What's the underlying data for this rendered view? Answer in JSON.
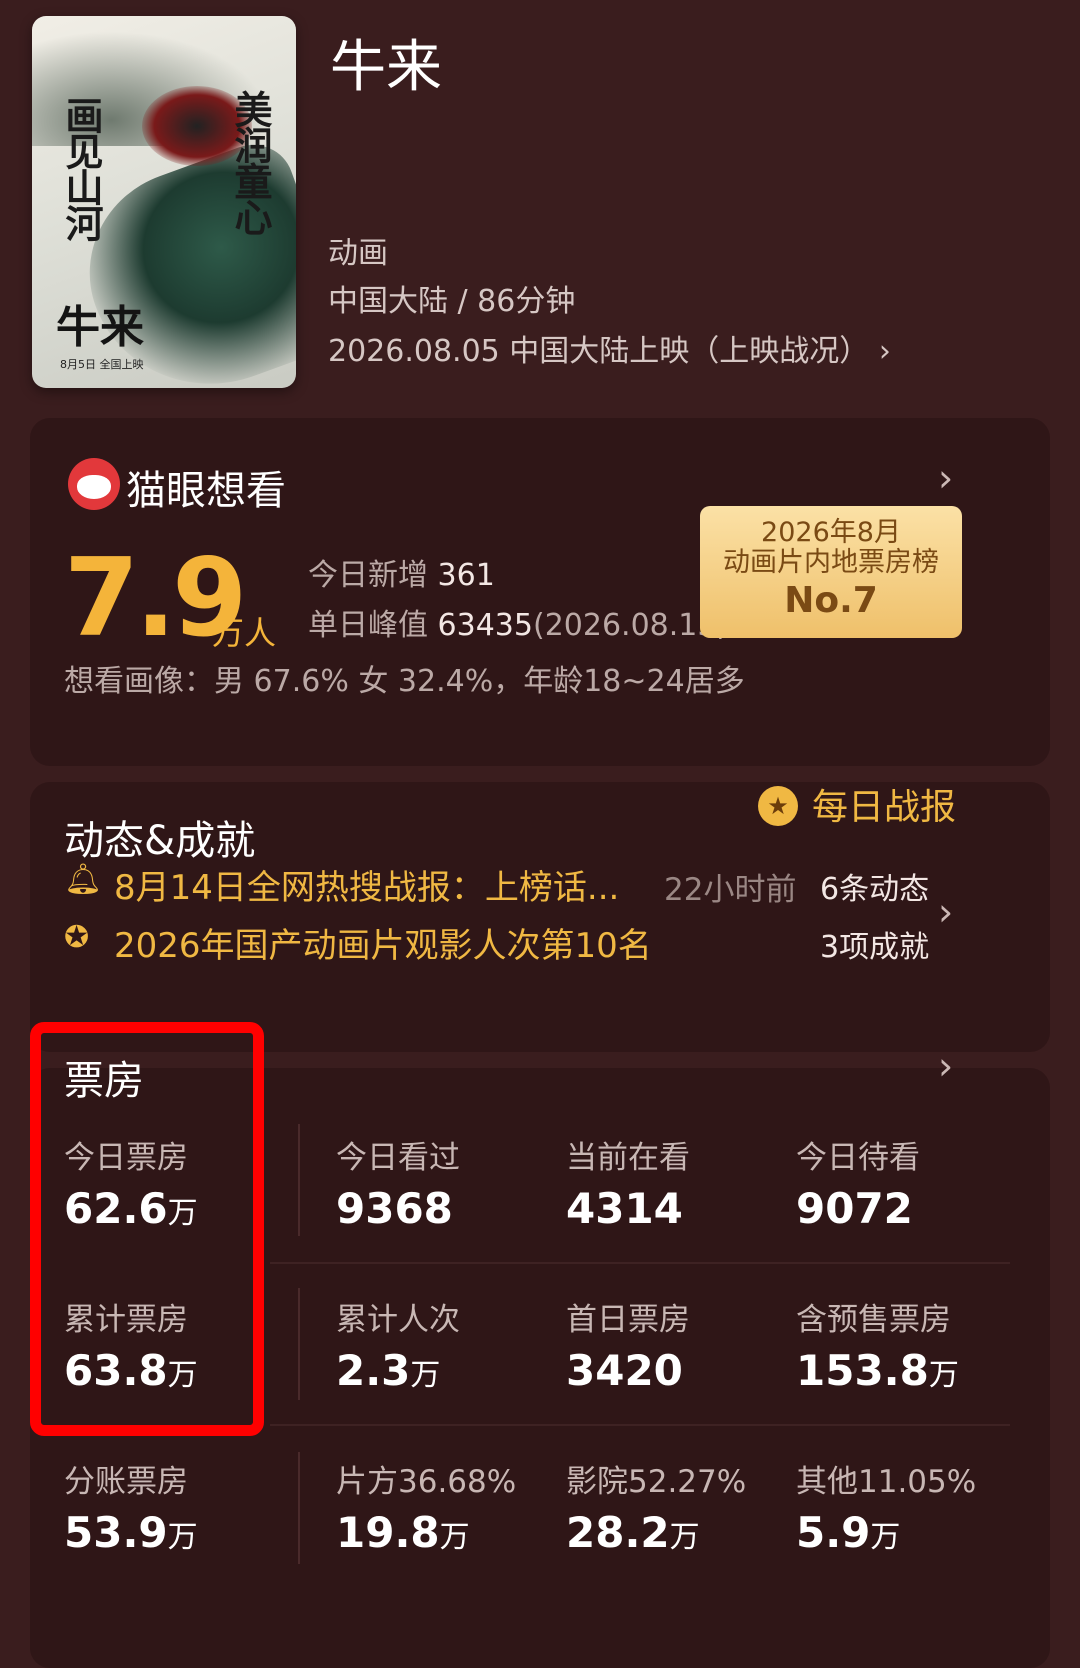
{
  "movie": {
    "title": "牛来",
    "genre": "动画",
    "region_duration": "中国大陆 / 86分钟",
    "release": "2026.08.05 中国大陆上映（上映战况）",
    "poster": {
      "left_text": "画见山河",
      "right_text": "美润童心",
      "title": "牛来",
      "date": "8月5日  全国上映"
    }
  },
  "wish": {
    "brand": "猫眼想看",
    "count": "7.9",
    "unit": "万人",
    "today_new_label": "今日新增",
    "today_new_value": "361",
    "peak_label": "单日峰值",
    "peak_value": "63435",
    "peak_date": "(2026.08.15)",
    "badge_line1": "2026年8月",
    "badge_line2": "动画片内地票房榜",
    "badge_rank": "No.7",
    "profile": "想看画像：男 67.6% 女 32.4%，年龄18~24居多"
  },
  "news": {
    "title": "动态&成就",
    "daily_report": "每日战报",
    "item1": "8月14日全网热搜战报：上榜话...",
    "item1_time": "22小时前",
    "item1_count": "6条动态",
    "item2": "2026年国产动画片观影人次第10名",
    "item2_count": "3项成就"
  },
  "boxoffice": {
    "title": "票房",
    "rows": [
      [
        {
          "label": "今日票房",
          "value": "62.6",
          "unit": "万"
        },
        {
          "label": "今日看过",
          "value": "9368",
          "unit": ""
        },
        {
          "label": "当前在看",
          "value": "4314",
          "unit": ""
        },
        {
          "label": "今日待看",
          "value": "9072",
          "unit": ""
        }
      ],
      [
        {
          "label": "累计票房",
          "value": "63.8",
          "unit": "万"
        },
        {
          "label": "累计人次",
          "value": "2.3",
          "unit": "万"
        },
        {
          "label": "首日票房",
          "value": "3420",
          "unit": ""
        },
        {
          "label": "含预售票房",
          "value": "153.8",
          "unit": "万"
        }
      ],
      [
        {
          "label": "分账票房",
          "value": "53.9",
          "unit": "万"
        },
        {
          "label": "片方36.68%",
          "value": "19.8",
          "unit": "万"
        },
        {
          "label": "影院52.27%",
          "value": "28.2",
          "unit": "万"
        },
        {
          "label": "其他11.05%",
          "value": "5.9",
          "unit": "万"
        }
      ]
    ]
  },
  "colors": {
    "background": "#3a1d1e",
    "card": "#2f1617",
    "accent_gold": "#f4b43a",
    "highlight_red": "#ff0000"
  }
}
